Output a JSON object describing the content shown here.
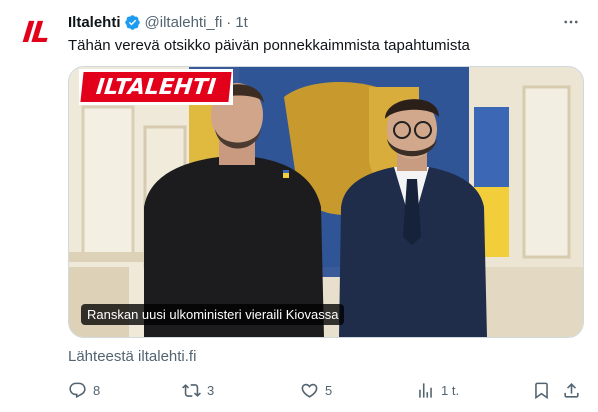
{
  "account": {
    "avatar_text": "IL",
    "name": "Iltalehti",
    "handle": "@iltalehti_fi",
    "separator": "·",
    "time": "1t",
    "verified_color": "#1d9bf0"
  },
  "tweet": {
    "text": "Tähän verevä otsikko päivän ponnekkaimmista tapahtumista"
  },
  "card": {
    "brand_logo_text": "ILTALEHTI",
    "caption": "Ranskan uusi ulkoministeri vieraili Kiovassa",
    "source": "Lähteestä iltalehti.fi"
  },
  "actions": {
    "reply": {
      "icon": "reply-icon",
      "count": "8"
    },
    "retweet": {
      "icon": "retweet-icon",
      "count": "3"
    },
    "like": {
      "icon": "heart-icon",
      "count": "5"
    },
    "views": {
      "icon": "views-icon",
      "count": "1 t."
    },
    "bookmark": {
      "icon": "bookmark-icon"
    },
    "share": {
      "icon": "share-icon"
    }
  },
  "colors": {
    "brand_red": "#e3001b",
    "muted_text": "#536471",
    "text": "#0f1419"
  }
}
